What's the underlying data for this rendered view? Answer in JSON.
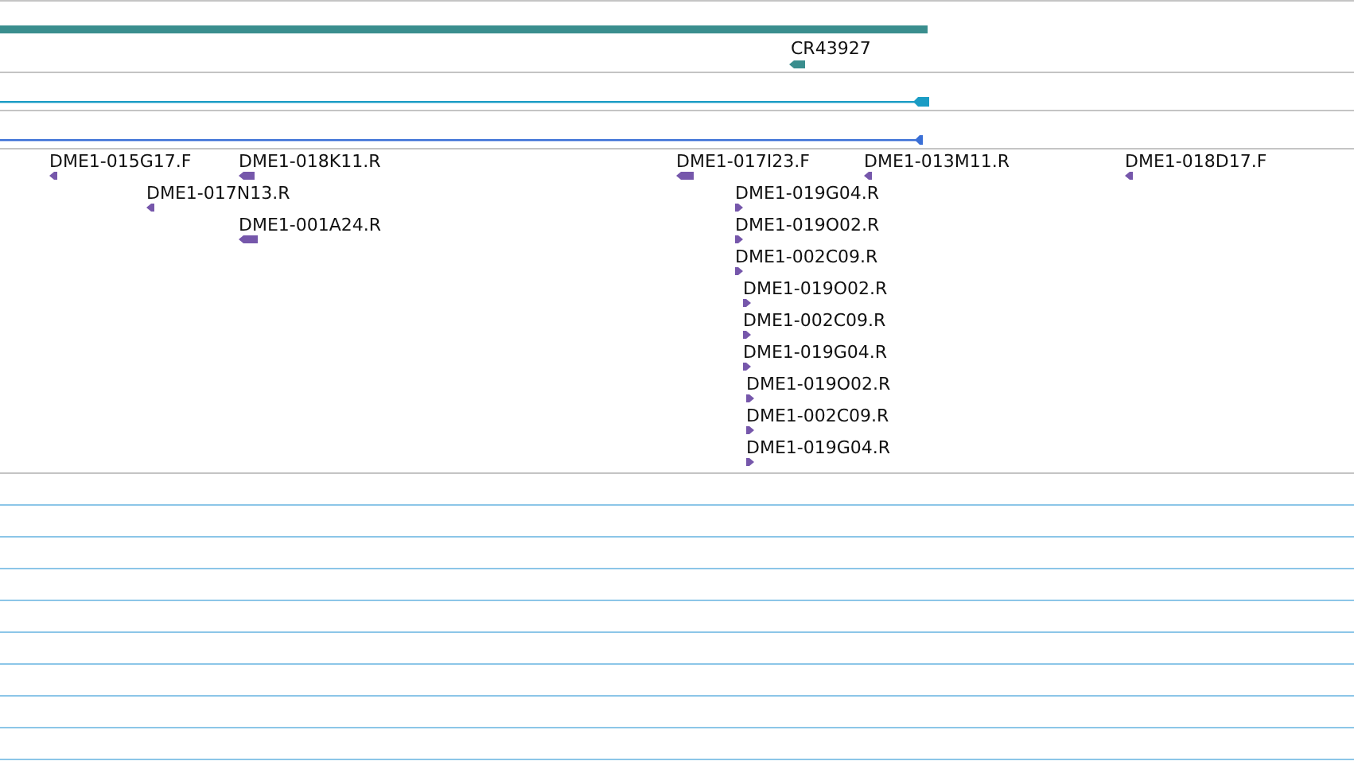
{
  "tracks": [
    {
      "kind": "gene",
      "color": "#3a8e8e",
      "features": [
        {
          "label": "CR43927",
          "reverse": true
        }
      ]
    },
    {
      "kind": "transcript",
      "color": "#1a9cc4",
      "features": [
        {
          "reverse": true
        }
      ]
    },
    {
      "kind": "transcript",
      "color": "#3a6fd6",
      "features": [
        {
          "reverse": true
        }
      ]
    },
    {
      "kind": "clones",
      "color": "#7657ab",
      "features": [
        {
          "label": "DME1-015G17.F",
          "reverse": true
        },
        {
          "label": "DME1-018K11.R",
          "reverse": true
        },
        {
          "label": "DME1-017I23.F",
          "reverse": true
        },
        {
          "label": "DME1-013M11.R",
          "reverse": true
        },
        {
          "label": "DME1-018D17.F",
          "reverse": true
        },
        {
          "label": "DME1-017N13.R",
          "reverse": true
        },
        {
          "label": "DME1-019G04.R",
          "reverse": false
        },
        {
          "label": "DME1-001A24.R",
          "reverse": true
        },
        {
          "label": "DME1-019O02.R",
          "reverse": false
        },
        {
          "label": "DME1-002C09.R",
          "reverse": false
        },
        {
          "label": "DME1-019O02.R",
          "reverse": false
        },
        {
          "label": "DME1-002C09.R",
          "reverse": false
        },
        {
          "label": "DME1-019G04.R",
          "reverse": false
        },
        {
          "label": "DME1-019O02.R",
          "reverse": false
        },
        {
          "label": "DME1-002C09.R",
          "reverse": false
        },
        {
          "label": "DME1-019G04.R",
          "reverse": false
        }
      ]
    }
  ]
}
